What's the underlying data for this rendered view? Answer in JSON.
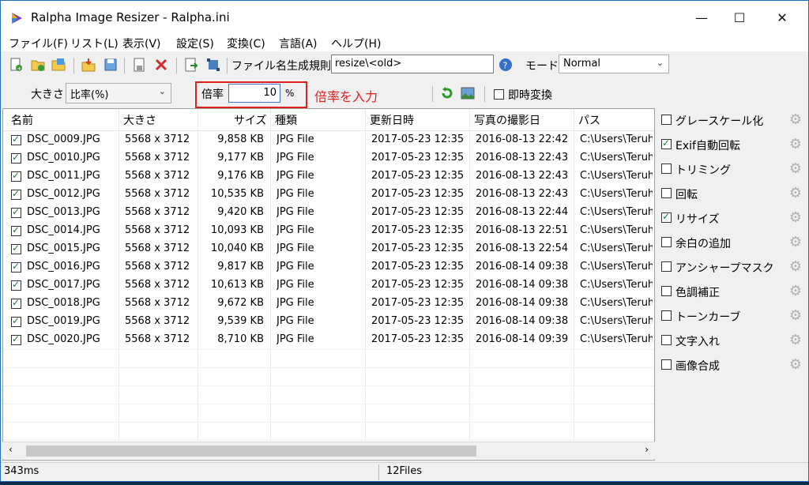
{
  "window": {
    "title": "Ralpha Image Resizer - Ralpha.ini",
    "controls": {
      "minimize": "—",
      "maximize": "☐",
      "close": "✕"
    }
  },
  "menu": [
    "ファイル(F)",
    "リスト(L)",
    "表示(V)",
    "設定(S)",
    "変換(C)",
    "言語(A)",
    "ヘルプ(H)"
  ],
  "toolbar": {
    "filename_rule_label": "ファイル名生成規則",
    "filename_rule_value": "resize\\<old>",
    "mode_label": "モード",
    "mode_value": "Normal"
  },
  "toolbar2": {
    "size_label": "大きさ",
    "size_value": "比率(%)",
    "ratio_label": "倍率",
    "ratio_value": "10",
    "percent": "%",
    "annotation": "倍率を入力",
    "instant_convert": "即時変換"
  },
  "columns": [
    "名前",
    "大きさ",
    "サイズ",
    "種類",
    "更新日時",
    "写真の撮影日",
    "パス"
  ],
  "files": [
    {
      "name": "DSC_0009.JPG",
      "dims": "5568 x 3712",
      "size": "9,858 KB",
      "type": "JPG File",
      "modified": "2017-05-23 12:35",
      "taken": "2016-08-13 22:42",
      "path": "C:\\Users\\Teruh"
    },
    {
      "name": "DSC_0010.JPG",
      "dims": "5568 x 3712",
      "size": "9,177 KB",
      "type": "JPG File",
      "modified": "2017-05-23 12:35",
      "taken": "2016-08-13 22:43",
      "path": "C:\\Users\\Teruh"
    },
    {
      "name": "DSC_0011.JPG",
      "dims": "5568 x 3712",
      "size": "9,176 KB",
      "type": "JPG File",
      "modified": "2017-05-23 12:35",
      "taken": "2016-08-13 22:43",
      "path": "C:\\Users\\Teruh"
    },
    {
      "name": "DSC_0012.JPG",
      "dims": "5568 x 3712",
      "size": "10,535 KB",
      "type": "JPG File",
      "modified": "2017-05-23 12:35",
      "taken": "2016-08-13 22:43",
      "path": "C:\\Users\\Teruh"
    },
    {
      "name": "DSC_0013.JPG",
      "dims": "5568 x 3712",
      "size": "9,420 KB",
      "type": "JPG File",
      "modified": "2017-05-23 12:35",
      "taken": "2016-08-13 22:44",
      "path": "C:\\Users\\Teruh"
    },
    {
      "name": "DSC_0014.JPG",
      "dims": "5568 x 3712",
      "size": "10,093 KB",
      "type": "JPG File",
      "modified": "2017-05-23 12:35",
      "taken": "2016-08-13 22:51",
      "path": "C:\\Users\\Teruh"
    },
    {
      "name": "DSC_0015.JPG",
      "dims": "5568 x 3712",
      "size": "10,040 KB",
      "type": "JPG File",
      "modified": "2017-05-23 12:35",
      "taken": "2016-08-13 22:54",
      "path": "C:\\Users\\Teruh"
    },
    {
      "name": "DSC_0016.JPG",
      "dims": "5568 x 3712",
      "size": "9,817 KB",
      "type": "JPG File",
      "modified": "2017-05-23 12:35",
      "taken": "2016-08-14 09:38",
      "path": "C:\\Users\\Teruh"
    },
    {
      "name": "DSC_0017.JPG",
      "dims": "5568 x 3712",
      "size": "10,613 KB",
      "type": "JPG File",
      "modified": "2017-05-23 12:35",
      "taken": "2016-08-14 09:38",
      "path": "C:\\Users\\Teruh"
    },
    {
      "name": "DSC_0018.JPG",
      "dims": "5568 x 3712",
      "size": "9,672 KB",
      "type": "JPG File",
      "modified": "2017-05-23 12:35",
      "taken": "2016-08-14 09:38",
      "path": "C:\\Users\\Teruh"
    },
    {
      "name": "DSC_0019.JPG",
      "dims": "5568 x 3712",
      "size": "9,539 KB",
      "type": "JPG File",
      "modified": "2017-05-23 12:35",
      "taken": "2016-08-14 09:38",
      "path": "C:\\Users\\Teruh"
    },
    {
      "name": "DSC_0020.JPG",
      "dims": "5568 x 3712",
      "size": "8,710 KB",
      "type": "JPG File",
      "modified": "2017-05-23 12:35",
      "taken": "2016-08-14 09:39",
      "path": "C:\\Users\\Teruh"
    }
  ],
  "options": [
    {
      "label": "グレースケール化",
      "checked": false
    },
    {
      "label": "Exif自動回転",
      "checked": true
    },
    {
      "label": "トリミング",
      "checked": false
    },
    {
      "label": "回転",
      "checked": false
    },
    {
      "label": "リサイズ",
      "checked": true
    },
    {
      "label": "余白の追加",
      "checked": false
    },
    {
      "label": "アンシャープマスク",
      "checked": false
    },
    {
      "label": "色調補正",
      "checked": false
    },
    {
      "label": "トーンカーブ",
      "checked": false
    },
    {
      "label": "文字入れ",
      "checked": false
    },
    {
      "label": "画像合成",
      "checked": false
    }
  ],
  "status": {
    "time": "343ms",
    "count": "12Files"
  },
  "colors": {
    "annotation": "#e02020",
    "check": "#1b7b2f"
  }
}
